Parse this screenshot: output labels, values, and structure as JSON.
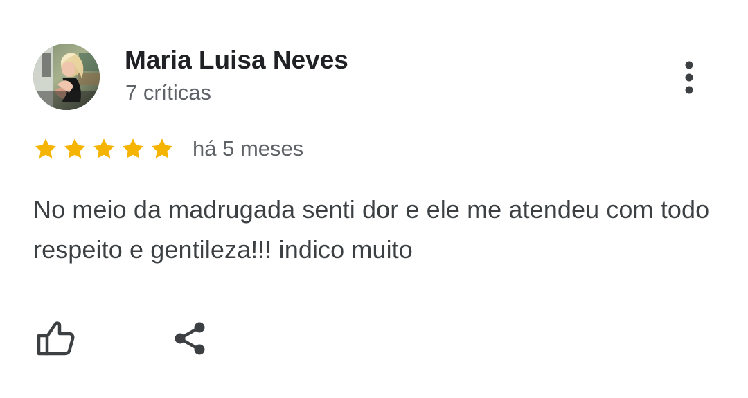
{
  "review": {
    "author_name": "Maria Luisa Neves",
    "author_meta": "7 críticas",
    "rating": 5,
    "rating_max": 5,
    "time_ago": "há 5 meses",
    "text": "No meio da madrugada senti dor e ele me atendeu com todo respeito e gentileza!!! indico muito"
  },
  "icons": {
    "avatar": "avatar",
    "more": "more-vertical-icon",
    "star": "star-icon",
    "like": "thumbs-up-icon",
    "share": "share-icon"
  },
  "colors": {
    "star": "#F4B400",
    "text": "#3C4043",
    "muted": "#5F6368",
    "icon": "#3C4043",
    "background": "#FFFFFF"
  }
}
